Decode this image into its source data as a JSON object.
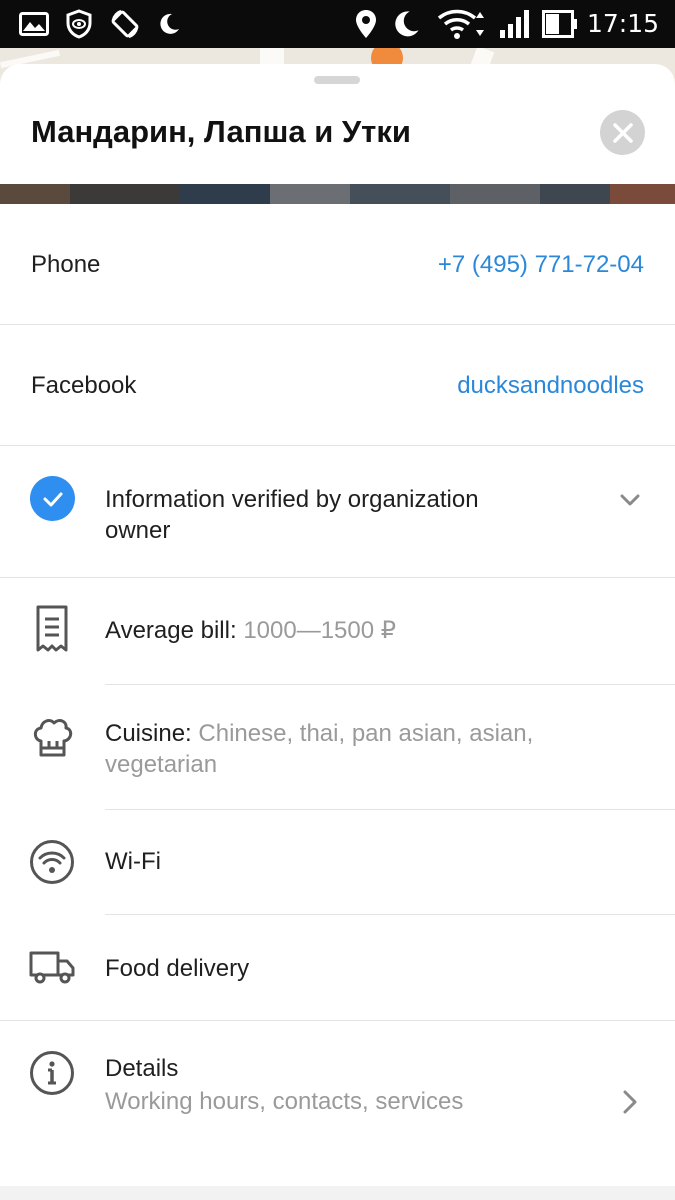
{
  "status_bar": {
    "time": "17:15",
    "left_icons": [
      "image-icon",
      "shield-eye-icon",
      "screen-rotate-icon",
      "moon-icon"
    ],
    "right_icons": [
      "location-pin-icon",
      "moon-icon",
      "wifi-icon",
      "signal-icon",
      "battery-icon"
    ]
  },
  "sheet": {
    "title": "Мандарин, Лапша и Утки",
    "close_icon": "close-icon"
  },
  "contacts": {
    "phone_label": "Phone",
    "phone_value": "+7 (495) 771-72-04",
    "facebook_label": "Facebook",
    "facebook_value": "ducksandnoodles"
  },
  "verified": {
    "line1": "Information verified by organization",
    "line2": "owner",
    "icon": "check-circle-icon"
  },
  "features": {
    "average_bill_label": "Average bill:",
    "average_bill_value": "1000—1500 ₽",
    "cuisine_label": "Cuisine:",
    "cuisine_value_line1": "Chinese, thai, pan asian, asian,",
    "cuisine_value_line2": "vegetarian",
    "wifi_label": "Wi-Fi",
    "delivery_label": "Food delivery"
  },
  "details": {
    "title": "Details",
    "subtitle": "Working hours, contacts, services"
  },
  "colors": {
    "link": "#2b88d9",
    "verified": "#2f8ff0",
    "muted": "#9a9a9a",
    "status_bar": "#0b0b0b"
  }
}
